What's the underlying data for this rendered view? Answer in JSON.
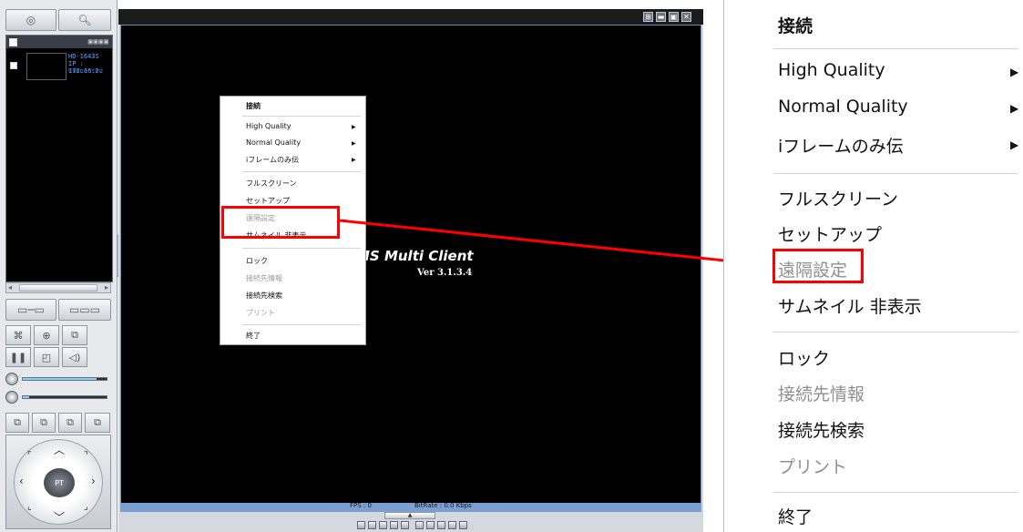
{
  "left_panel": {
    "camera": {
      "name": "HD-1643S",
      "ip": "IP : 172.16.2.",
      "status": "Connected"
    },
    "ptz_label": "PT"
  },
  "main_window": {
    "splash_title": "MS Multi Client",
    "splash_version": "Ver 3.1.3.4",
    "fps": "FPS :  0",
    "bitrate": "BitRate :  0.0 Kbps"
  },
  "context_menu": {
    "items": [
      {
        "label": "接続",
        "enabled": true,
        "submenu": false
      },
      {
        "label": "High Quality",
        "enabled": true,
        "submenu": true
      },
      {
        "label": "Normal Quality",
        "enabled": true,
        "submenu": true
      },
      {
        "label": "iフレームのみ伝",
        "enabled": true,
        "submenu": true
      },
      {
        "label": "フルスクリーン",
        "enabled": true,
        "submenu": false
      },
      {
        "label": "セットアップ",
        "enabled": true,
        "submenu": false
      },
      {
        "label": "遠隔設定",
        "enabled": false,
        "submenu": false
      },
      {
        "label": "サムネイル 非表示",
        "enabled": true,
        "submenu": false
      },
      {
        "label": "ロック",
        "enabled": true,
        "submenu": false
      },
      {
        "label": "接続先情報",
        "enabled": false,
        "submenu": false
      },
      {
        "label": "接続先検索",
        "enabled": true,
        "submenu": false
      },
      {
        "label": "プリント",
        "enabled": false,
        "submenu": false
      },
      {
        "label": "終了",
        "enabled": true,
        "submenu": false
      }
    ],
    "highlighted_item": "遠隔設定"
  },
  "colors": {
    "highlight": "#ff0000",
    "video_background": "#000000",
    "disabled_text": "#8f8f8f"
  }
}
